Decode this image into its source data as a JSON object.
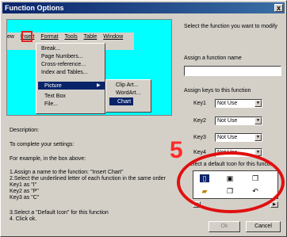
{
  "window": {
    "title": "Function Options",
    "close_glyph": "x"
  },
  "preview": {
    "menubar": [
      "ew",
      "Insert",
      "Format",
      "Tools",
      "Table",
      "Window"
    ],
    "insert_menu": [
      "Break...",
      "Page Numbers...",
      "Cross-reference...",
      "Index and Tables...",
      "Picture",
      "Text Box",
      "File..."
    ],
    "picture_submenu": [
      "Clip Art...",
      "WordArt...",
      "Chart"
    ]
  },
  "right": {
    "select_prompt": "Select the function you want to modify",
    "assign_name_label": "Assign a function name",
    "name_value": "",
    "assign_keys_label": "Assign keys to this function",
    "keys": [
      {
        "label": "Key1",
        "value": "Not Use"
      },
      {
        "label": "Key2",
        "value": "Not Use"
      },
      {
        "label": "Key3",
        "value": "Not Use"
      },
      {
        "label": "Key4",
        "value": "Not Use"
      }
    ],
    "default_icon_label": "elect a default Icon for this functio"
  },
  "description": {
    "title": "Description:",
    "line1": "To complete your settings:",
    "line2": "For example, in the box above:",
    "step1": "1.Assign a name to the function: \"Insert Chart\"",
    "step2": "2.Select the underlined letter of each function in the same order",
    "key1": "Key1 as \"I\"",
    "key2": "Key2 as \"P\"",
    "key3": "Key3 as \"C\"",
    "step3": "3.Select a \"Default Icon\" for this function",
    "step4": "4. Click ok."
  },
  "buttons": {
    "ok": "Ok",
    "cancel": "Cancel"
  },
  "annotation": {
    "number": "5",
    "color": "#e01010"
  }
}
